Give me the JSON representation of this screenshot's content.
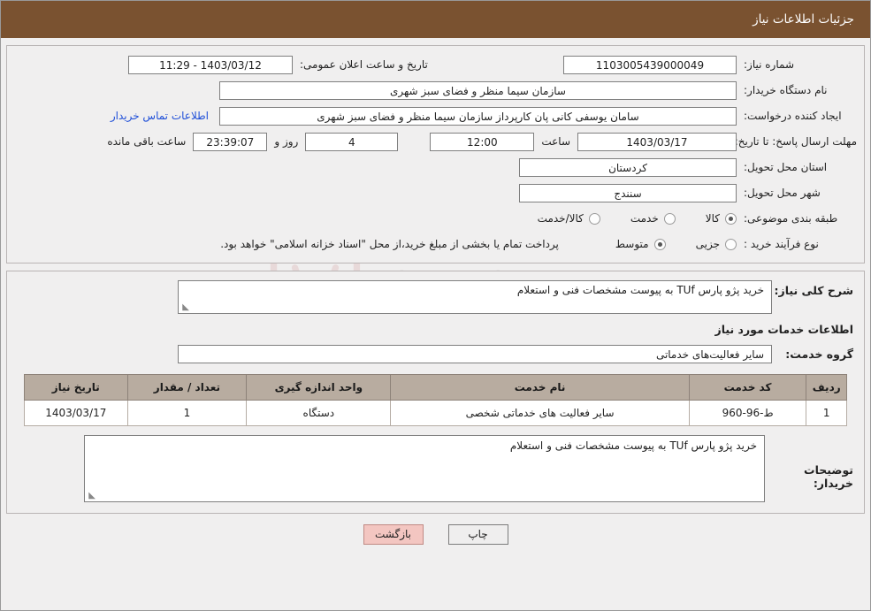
{
  "header": {
    "title": "جزئیات اطلاعات نیاز"
  },
  "watermark": {
    "text": "AriaTender.net",
    "shield_icon": "shield-icon"
  },
  "form": {
    "need_number_label": "شماره نیاز:",
    "need_number_value": "1103005439000049",
    "announce_datetime_label": "تاریخ و ساعت اعلان عمومی:",
    "announce_datetime_value": "11:29 - 1403/03/12",
    "buyer_org_label": "نام دستگاه خریدار:",
    "buyer_org_value": "سازمان سیما  منظر و فضای سبز شهری",
    "requester_label": "ایجاد کننده درخواست:",
    "requester_value": "سامان یوسفی کانی پان کارپرداز سازمان سیما  منظر و فضای سبز شهری",
    "contact_link": "اطلاعات تماس خریدار",
    "deadline_label": "مهلت ارسال پاسخ: تا تاریخ:",
    "deadline_date": "1403/03/17",
    "deadline_time_label": "ساعت",
    "deadline_time": "12:00",
    "remaining_days": "4",
    "remaining_days_label": "روز و",
    "remaining_clock": "23:39:07",
    "remaining_suffix": "ساعت باقی مانده",
    "province_label": "استان محل تحویل:",
    "province_value": "کردستان",
    "city_label": "شهر محل تحویل:",
    "city_value": "سنندج",
    "category_label": "طبقه بندی موضوعی:",
    "category_options": [
      "کالا",
      "خدمت",
      "کالا/خدمت"
    ],
    "category_selected": "کالا",
    "process_label": "نوع فرآیند خرید :",
    "process_options": [
      "جزیی",
      "متوسط"
    ],
    "process_selected": "متوسط",
    "process_note": "پرداخت تمام یا بخشی از مبلغ خرید،از محل \"اسناد خزانه اسلامی\" خواهد بود."
  },
  "details": {
    "summary_label": "شرح کلی نیاز:",
    "summary_value": "خرید پژو پارس TUf به پیوست مشخصات فنی و استعلام",
    "services_heading": "اطلاعات خدمات مورد نیاز",
    "service_group_label": "گروه خدمت:",
    "service_group_value": "سایر فعالیت‌های خدماتی",
    "table": {
      "columns": [
        "ردیف",
        "کد خدمت",
        "نام خدمت",
        "واحد اندازه گیری",
        "تعداد / مقدار",
        "تاریخ نیاز"
      ],
      "rows": [
        {
          "index": "1",
          "code": "ط-96-960",
          "name": "سایر فعالیت های خدماتی شخصی",
          "unit": "دستگاه",
          "quantity": "1",
          "date": "1403/03/17"
        }
      ]
    },
    "buyer_notes_label": "توضیحات خریدار:",
    "buyer_notes_value": "خرید پژو پارس TUf به پیوست مشخصات فنی و استعلام"
  },
  "footer": {
    "print_label": "چاپ",
    "back_label": "بازگشت"
  }
}
